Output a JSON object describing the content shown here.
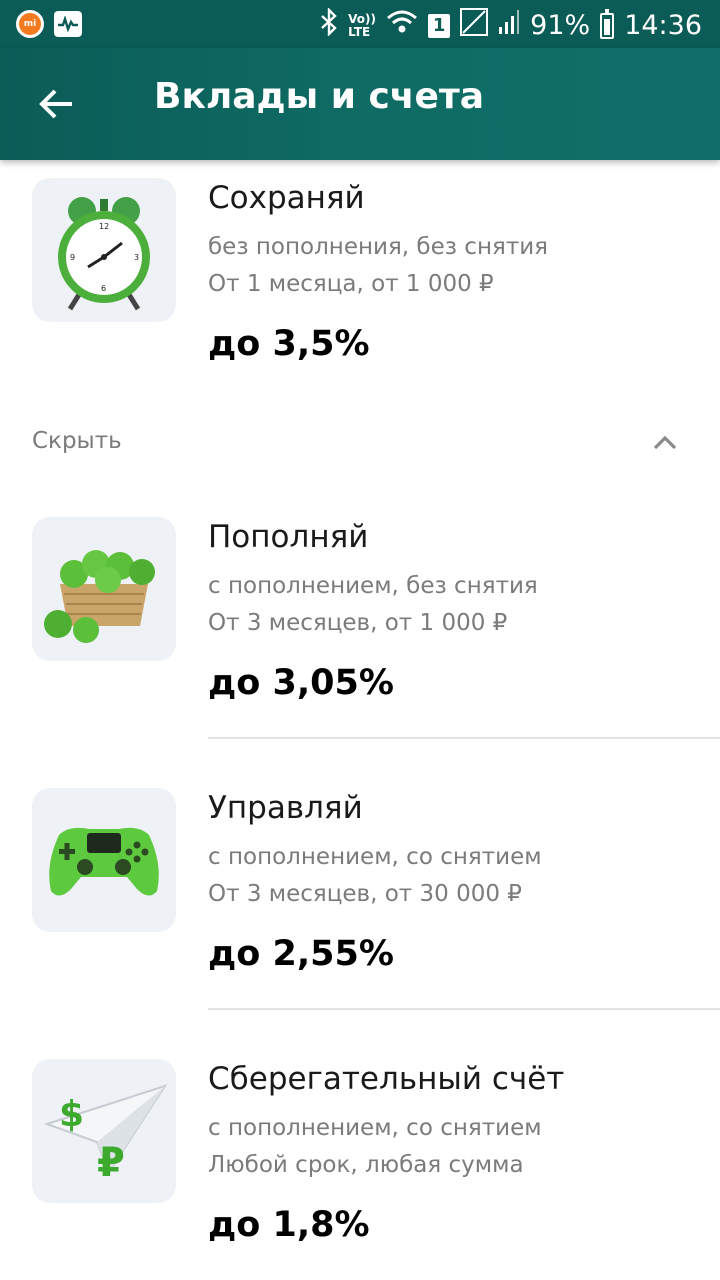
{
  "status_bar": {
    "volte": "Vo)) LTE",
    "sim": "1",
    "battery": "91%",
    "time": "14:36"
  },
  "app_bar": {
    "title": "Вклады и счета"
  },
  "deposits": [
    {
      "title": "Сохраняй",
      "sub1": "без пополнения, без снятия",
      "sub2": "От 1 месяца, от 1 000 ₽",
      "rate": "до 3,5%",
      "icon": "alarm-clock-icon"
    },
    {
      "title": "Пополняй",
      "sub1": "с пополнением, без снятия",
      "sub2": "От 3 месяцев, от 1 000 ₽",
      "rate": "до 3,05%",
      "icon": "apple-basket-icon"
    },
    {
      "title": "Управляй",
      "sub1": "с пополнением, со снятием",
      "sub2": "От 3 месяцев, от 30 000 ₽",
      "rate": "до 2,55%",
      "icon": "gamepad-icon"
    },
    {
      "title": "Сберегательный счёт",
      "sub1": "с пополнением, со снятием",
      "sub2": "Любой срок, любая сумма",
      "rate": "до 1,8%",
      "icon": "paper-plane-money-icon"
    }
  ],
  "toggle": {
    "label": "Скрыть"
  },
  "colors": {
    "accent": "#0b5c57",
    "green": "#4caf3c",
    "muted_text": "#7b7b7b"
  }
}
